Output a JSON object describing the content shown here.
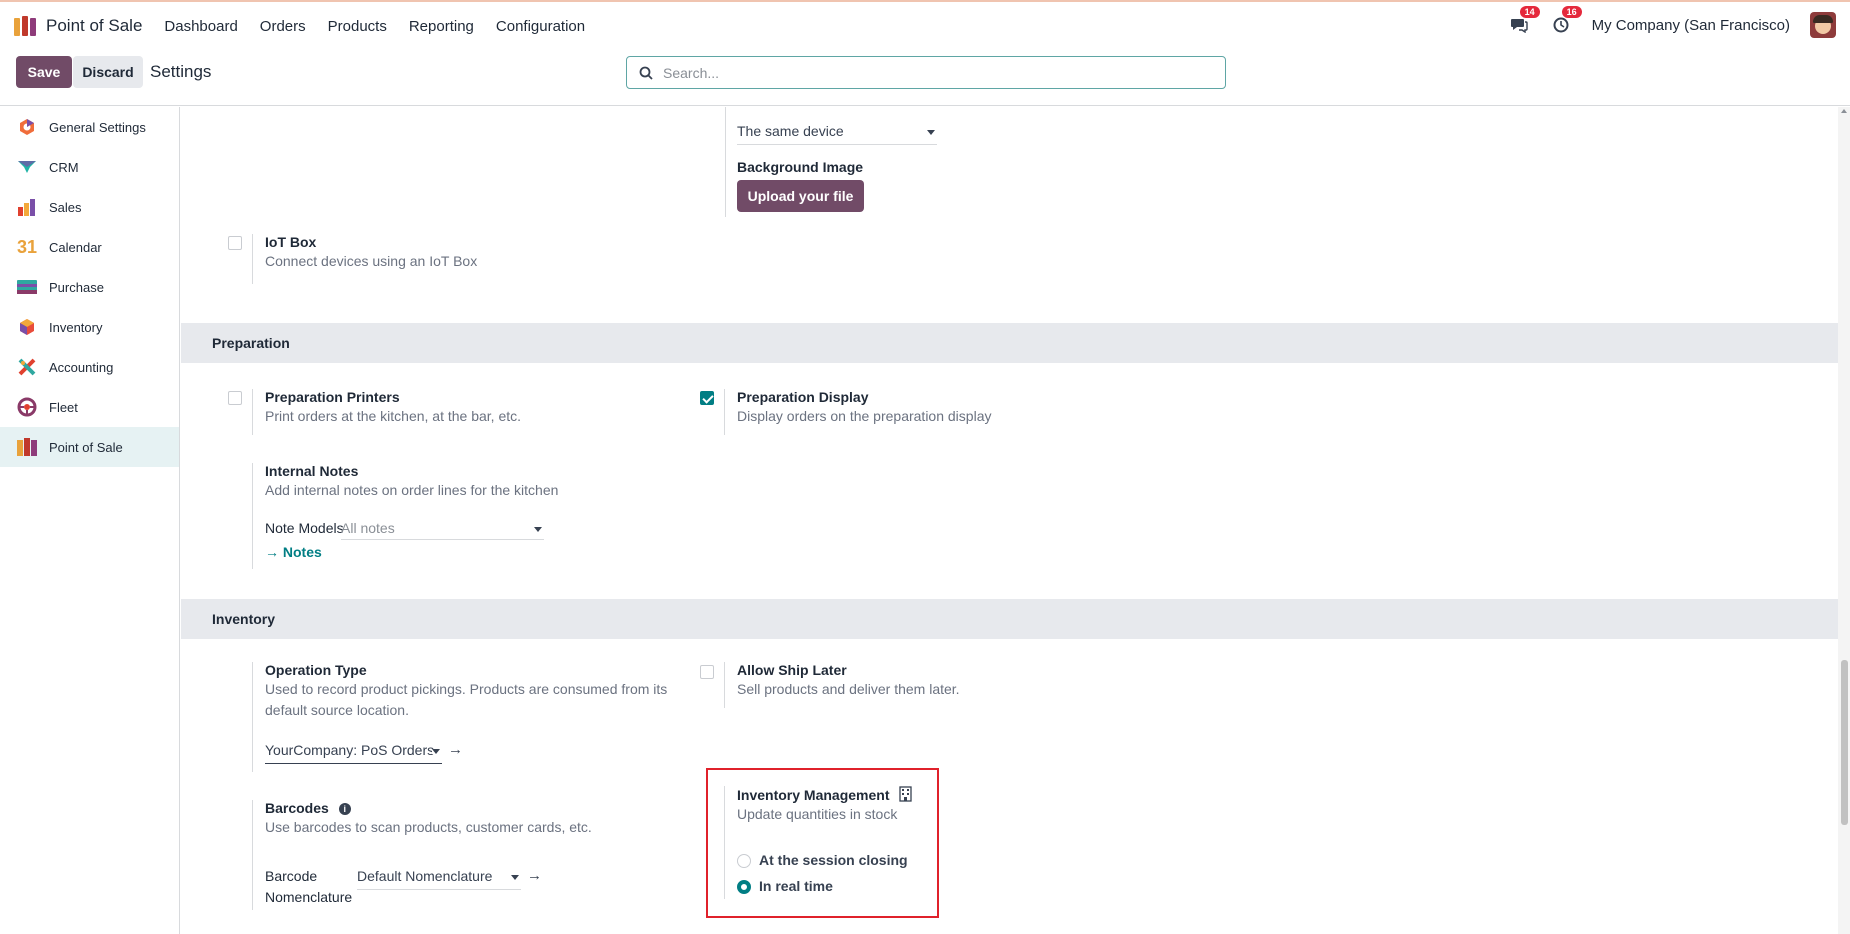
{
  "topbar": {
    "app_name": "Point of Sale",
    "menu": [
      "Dashboard",
      "Orders",
      "Products",
      "Reporting",
      "Configuration"
    ],
    "messages_count": "14",
    "activities_count": "16",
    "company": "My Company (San Francisco)"
  },
  "controlbar": {
    "save_label": "Save",
    "discard_label": "Discard",
    "breadcrumb": "Settings",
    "search_placeholder": "Search..."
  },
  "sidebar": {
    "items": [
      {
        "label": "General Settings",
        "icon": "general-settings-icon"
      },
      {
        "label": "CRM",
        "icon": "crm-icon"
      },
      {
        "label": "Sales",
        "icon": "sales-icon"
      },
      {
        "label": "Calendar",
        "icon": "calendar-icon",
        "icon_text": "31"
      },
      {
        "label": "Purchase",
        "icon": "purchase-icon"
      },
      {
        "label": "Inventory",
        "icon": "inventory-icon"
      },
      {
        "label": "Accounting",
        "icon": "accounting-icon"
      },
      {
        "label": "Fleet",
        "icon": "fleet-icon"
      },
      {
        "label": "Point of Sale",
        "icon": "point-of-sale-icon",
        "active": true
      }
    ]
  },
  "upper": {
    "device_select": "The same device",
    "background_image_label": "Background Image",
    "upload_label": "Upload your file",
    "iot_title": "IoT Box",
    "iot_desc": "Connect devices using an IoT Box"
  },
  "preparation": {
    "header": "Preparation",
    "printers_title": "Preparation Printers",
    "printers_desc": "Print orders at the kitchen, at the bar, etc.",
    "printers_checked": false,
    "display_title": "Preparation Display",
    "display_desc": "Display orders on the preparation display",
    "display_checked": true,
    "notes_title": "Internal Notes",
    "notes_desc": "Add internal notes on order lines for the kitchen",
    "note_models_label": "Note Models",
    "note_models_placeholder": "All notes",
    "notes_link": "Notes"
  },
  "inventory": {
    "header": "Inventory",
    "op_type_title": "Operation Type",
    "op_type_desc": "Used to record product pickings. Products are consumed from its default source location.",
    "op_type_value": "YourCompany: PoS Orders",
    "ship_later_title": "Allow Ship Later",
    "ship_later_desc": "Sell products and deliver them later.",
    "ship_later_checked": false,
    "barcodes_title": "Barcodes",
    "barcodes_desc": "Use barcodes to scan products, customer cards, etc.",
    "barcode_nomenclature_label": "Barcode Nomenclature",
    "barcode_nomenclature_value": "Default Nomenclature",
    "inv_mgmt_title": "Inventory Management",
    "inv_mgmt_desc": "Update quantities in stock",
    "radio_options": [
      "At the session closing",
      "In real time"
    ],
    "radio_selected": "In real time"
  },
  "colors": {
    "brand": "#714b67",
    "teal": "#017e84",
    "highlight_box": "#e0212b",
    "section_bg": "#e7e9ed"
  }
}
